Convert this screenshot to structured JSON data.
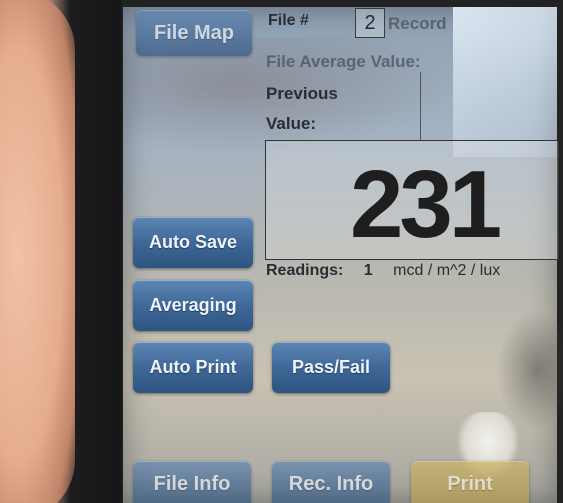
{
  "header": {
    "file_map_label": "File Map",
    "file_num_label": "File #",
    "file_num_value": "2",
    "record_label": "Record",
    "file_avg_label": "File Average Value:",
    "previous_label": "Previous",
    "value_label": "Value:"
  },
  "display": {
    "reading": "231"
  },
  "readings": {
    "label": "Readings:",
    "count": "1",
    "unit": "mcd / m^2 / lux"
  },
  "buttons": {
    "auto_save": "Auto Save",
    "averaging": "Averaging",
    "auto_print": "Auto Print",
    "pass_fail": "Pass/Fail",
    "file_info": "File Info",
    "rec_info": "Rec. Info",
    "print": "Print"
  }
}
